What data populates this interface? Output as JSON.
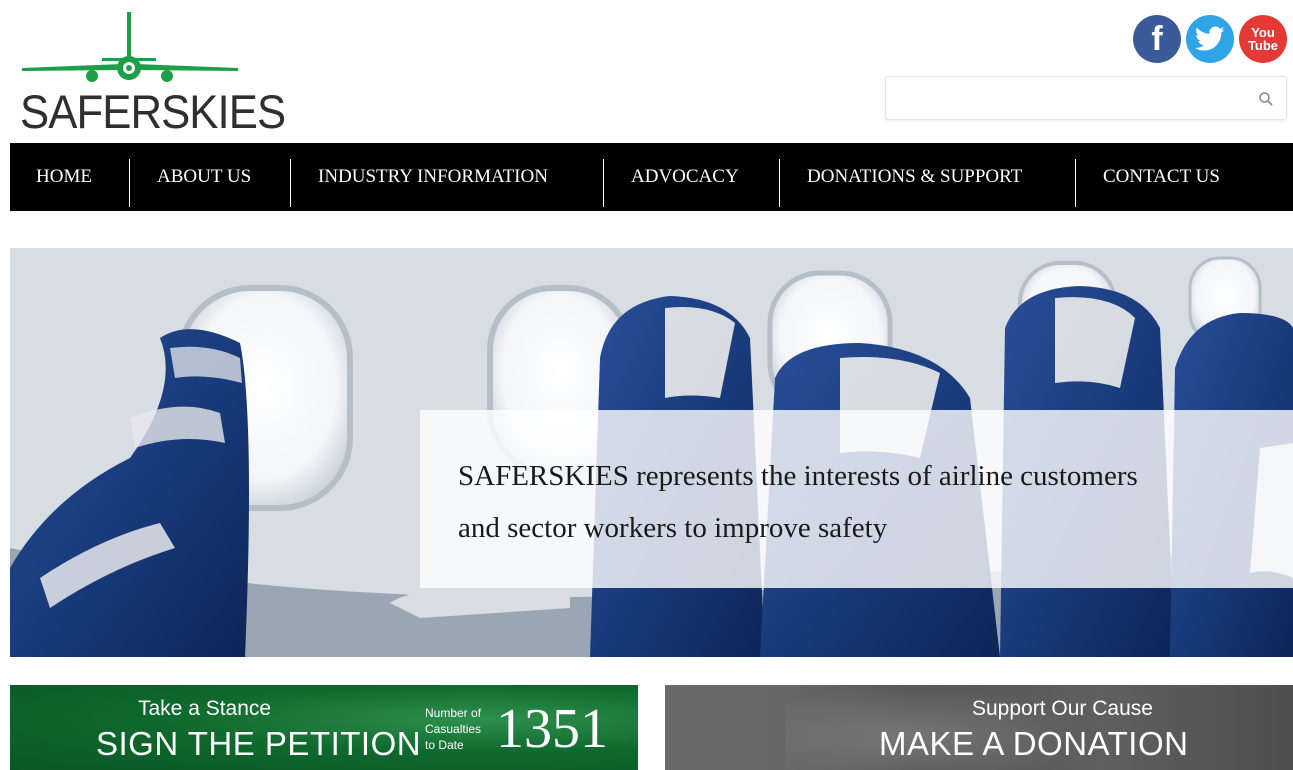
{
  "logo": {
    "text": "SAFERSKIES",
    "icon": "airplane-icon"
  },
  "social": {
    "facebook": {
      "glyph": "f",
      "icon": "facebook-icon",
      "color": "#3b5a9a"
    },
    "twitter": {
      "icon": "twitter-icon",
      "color": "#2fa4e7"
    },
    "youtube": {
      "line1": "You",
      "line2": "Tube",
      "icon": "youtube-icon",
      "color": "#e33a36"
    }
  },
  "search": {
    "value": "",
    "placeholder": "",
    "icon": "search-icon"
  },
  "nav": {
    "items": [
      {
        "label": "HOME"
      },
      {
        "label": "ABOUT US"
      },
      {
        "label": "INDUSTRY INFORMATION"
      },
      {
        "label": "ADVOCACY"
      },
      {
        "label": "DONATIONS & SUPPORT"
      },
      {
        "label": "CONTACT US"
      }
    ]
  },
  "hero": {
    "line1": "SAFERSKIES represents the interests of airline customers",
    "line2": "and sector workers to improve safety"
  },
  "petition": {
    "subtitle": "Take a Stance",
    "title": "SIGN THE PETITION",
    "counter_label_1": "Number of",
    "counter_label_2": "Casualties",
    "counter_label_3": "to Date",
    "count": "1351",
    "color": "#0f6a2e"
  },
  "donation": {
    "subtitle": "Support Our Cause",
    "title": "MAKE A DONATION"
  },
  "colors": {
    "nav_bg": "#000000",
    "logo_green": "#1f9e4a"
  }
}
